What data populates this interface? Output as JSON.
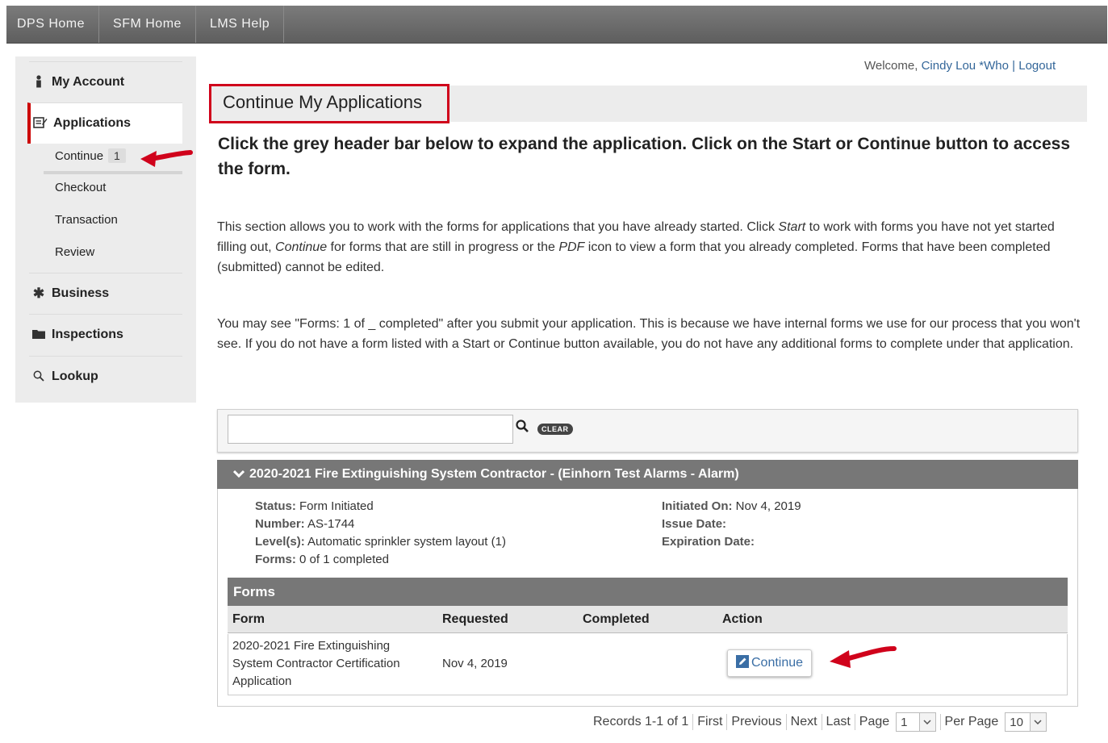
{
  "topnav": {
    "items": [
      "DPS Home",
      "SFM Home",
      "LMS Help"
    ]
  },
  "sidebar": {
    "my_account": "My Account",
    "applications": "Applications",
    "continue": "Continue",
    "continue_count": "1",
    "checkout": "Checkout",
    "transaction": "Transaction",
    "review": "Review",
    "business": "Business",
    "inspections": "Inspections",
    "lookup": "Lookup"
  },
  "header": {
    "welcome": "Welcome,",
    "user": "Cindy Lou *Who",
    "sep": "|",
    "logout": "Logout"
  },
  "page": {
    "title": "Continue My Applications",
    "heading": "Click the grey header bar below to expand the application.  Click on the Start or Continue button to access the form.",
    "para1_a": "This section allows you to work with the forms for applications that you have already started. Click ",
    "para1_start": "Start",
    "para1_b": " to work with forms you have not yet started filling out, ",
    "para1_continue": "Continue",
    "para1_c": " for forms that are still in progress or the ",
    "para1_pdf": "PDF",
    "para1_d": " icon to view a form that you already completed.  Forms that have been completed (submitted) cannot be edited.",
    "para2": "You may see \"Forms: 1 of _ completed\" after you submit your application.  This is because we have internal forms we use for our process that you won't see.  If you do not have a form listed with a Start or Continue button available, you do not have any additional forms to complete under that application."
  },
  "search": {
    "value": "",
    "clear_label": "CLEAR"
  },
  "application": {
    "title": "2020-2021 Fire Extinguishing System Contractor - (Einhorn Test Alarms - Alarm)",
    "status_label": "Status:",
    "status": "Form Initiated",
    "number_label": "Number:",
    "number": "AS-1744",
    "levels_label": "Level(s):",
    "levels": "Automatic sprinkler system layout (1)",
    "forms_label": "Forms:",
    "forms": "0 of 1 completed",
    "initiated_label": "Initiated On:",
    "initiated": "Nov 4, 2019",
    "issue_label": "Issue Date:",
    "issue": "",
    "expiration_label": "Expiration Date:",
    "expiration": ""
  },
  "forms_table": {
    "title": "Forms",
    "columns": [
      "Form",
      "Requested",
      "Completed",
      "Action"
    ],
    "rows": [
      {
        "form_line1": "2020-2021 Fire Extinguishing",
        "form_line2": "System Contractor Certification",
        "form_line3": "Application",
        "requested": "Nov 4, 2019",
        "completed": "",
        "action": "Continue"
      }
    ]
  },
  "pager": {
    "records": "Records 1-1 of 1",
    "first": "First",
    "previous": "Previous",
    "next": "Next",
    "last": "Last",
    "page_label": "Page",
    "page_value": "1",
    "per_page_label": "Per Page",
    "per_page_value": "10"
  },
  "colors": {
    "annotation_red": "#d0021b",
    "link_blue": "#336699",
    "header_grey": "#777777"
  }
}
